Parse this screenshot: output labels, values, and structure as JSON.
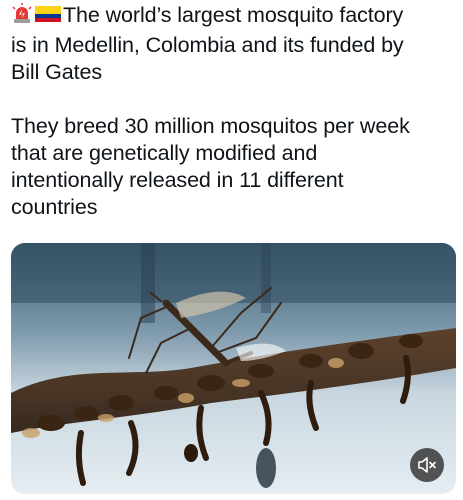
{
  "post": {
    "emojis": [
      "siren-emoji",
      "colombia-flag-emoji"
    ],
    "lines": [
      "The world’s largest mosquito factory",
      "is in Medellin, Colombia and its funded by",
      "Bill Gates",
      "",
      "They breed 30 million mosquitos per week",
      "that are genetically modified and",
      "intentionally released in 11 different",
      "countries"
    ]
  },
  "media": {
    "type": "video",
    "muted": true,
    "mute_icon": "speaker-muted-icon"
  },
  "colors": {
    "text": "#0f1419",
    "siren_red": "#e53935",
    "flag_yellow": "#fcd116",
    "flag_blue": "#003893",
    "flag_red": "#ce1126"
  }
}
